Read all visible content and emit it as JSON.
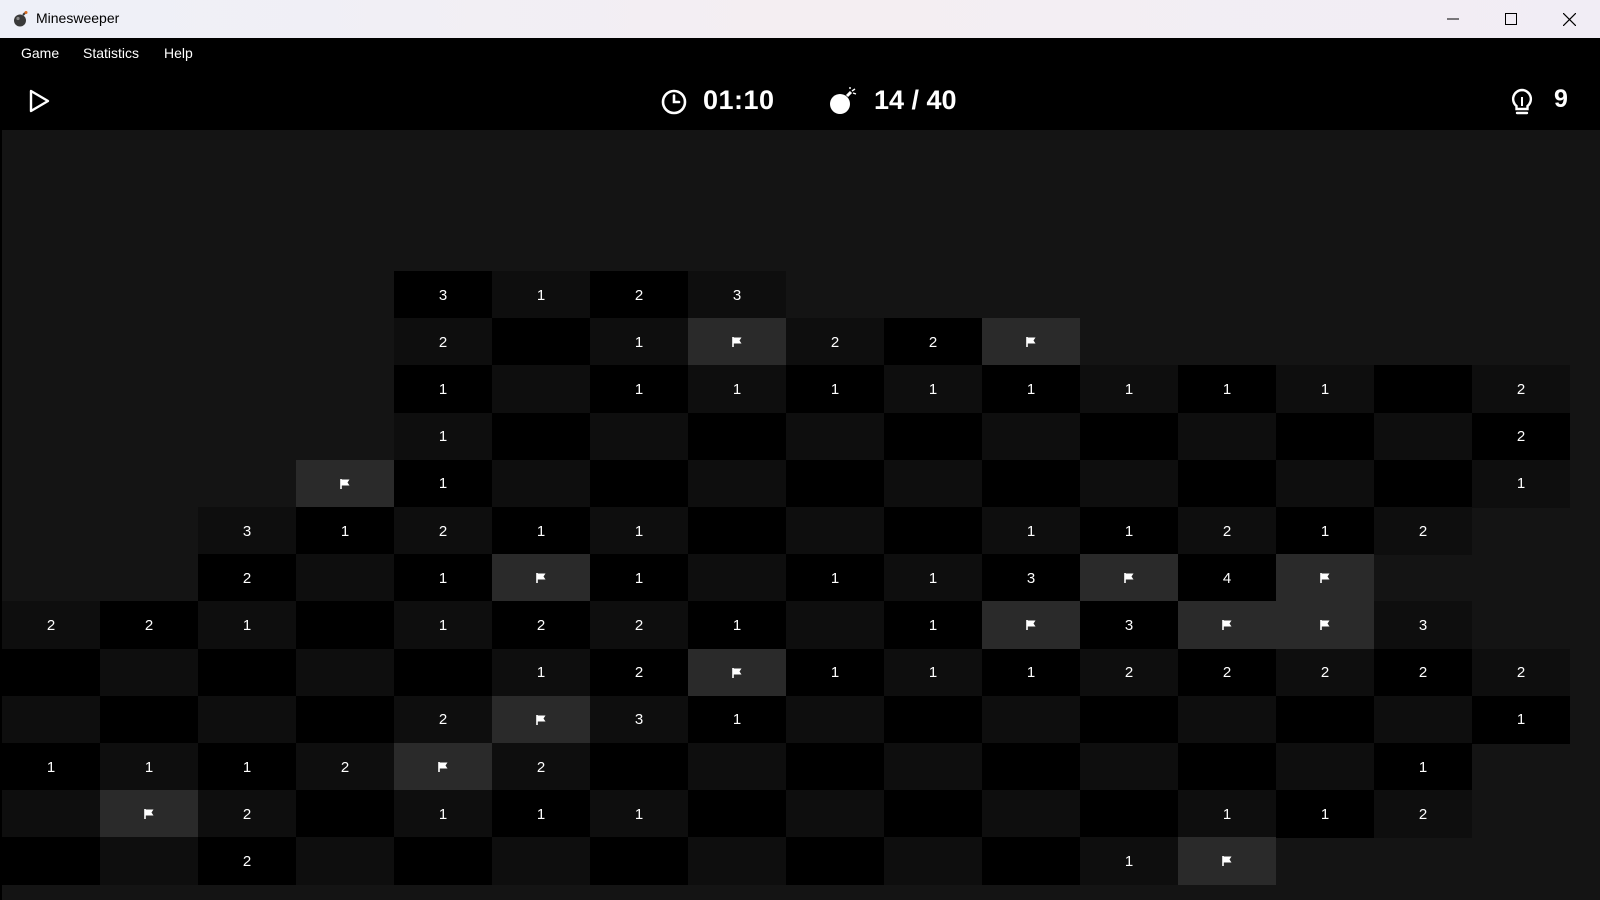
{
  "window": {
    "title": "Minesweeper",
    "icon": "bomb-icon"
  },
  "menu": {
    "items": [
      "Game",
      "Statistics",
      "Help"
    ]
  },
  "toolbar": {
    "play_icon": "play-icon",
    "timer_icon": "timer-icon",
    "timer": "01:10",
    "mine_icon": "bomb-icon",
    "mines": "14 / 40",
    "hint_icon": "lightbulb-icon",
    "hints": "9"
  },
  "board": {
    "columns": 16,
    "rows": 13,
    "colors": {
      "hidden": "#141414",
      "open_dark": "#000000",
      "open_light": "#0e0e0e",
      "flag_bg": "#2a2a2a"
    },
    "legend": {
      "F": "flag",
      "o": "open-empty",
      ".": "hidden",
      "digit": "adjacent-mine-count"
    },
    "grid": [
      "....3123........",
      "....2o1F22F.....",
      "....1o11111111 2",
      "....1oooooooooo2",
      "...F1ooooooooo01",
      "..3121100o11212.",
      "..2o1F1o113F4F..",
      "221o1221o1F3FF3.",
      "ooo o12F11122222",
      "oooo2F31ooooooo1",
      "1112F2oooooooo1.",
      "oF2o111ooooo112.",
      "oo2oooooooo1F..."
    ]
  }
}
